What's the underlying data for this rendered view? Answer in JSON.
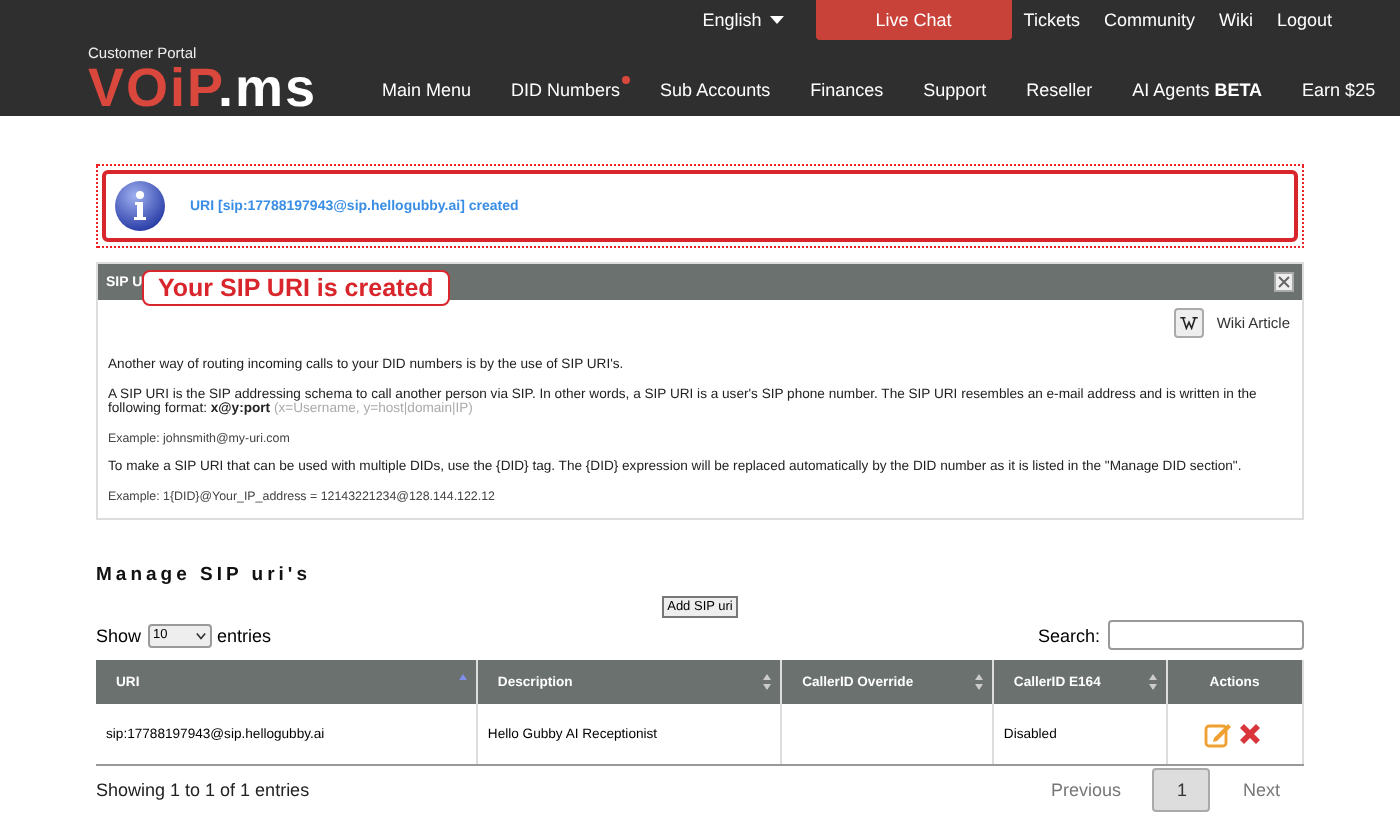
{
  "top_bar": {
    "language": "English",
    "items": [
      {
        "label": "Live Chat",
        "kind": "highlight"
      },
      {
        "label": "Tickets",
        "kind": "link"
      },
      {
        "label": "Community",
        "kind": "link"
      },
      {
        "label": "Wiki",
        "kind": "link"
      },
      {
        "label": "Logout",
        "kind": "link"
      }
    ]
  },
  "brand": {
    "caption": "Customer Portal",
    "logo_main": "VOiP",
    "logo_suffix": ".ms"
  },
  "nav": [
    {
      "label": "Main Menu",
      "badge": false
    },
    {
      "label": "DID Numbers",
      "badge": true
    },
    {
      "label": "Sub Accounts",
      "badge": false
    },
    {
      "label": "Finances",
      "badge": false
    },
    {
      "label": "Support",
      "badge": false
    },
    {
      "label": "Reseller",
      "badge": false
    },
    {
      "label": "AI Agents **BETA**",
      "badge": false
    },
    {
      "label": "Earn $25",
      "badge": false
    }
  ],
  "message": {
    "text": "URI [sip:17788197943@sip.hellogubby.ai] created"
  },
  "panel": {
    "title": "SIP U",
    "callout": "Your SIP URI is created",
    "wiki_link": "Wiki Article",
    "paragraphs": [
      {
        "kind": "text",
        "text": "Another way of routing incoming calls to your DID numbers is by the use of SIP URI's."
      },
      {
        "kind": "text",
        "text": "A SIP URI is the SIP addressing schema to call another person via SIP. In other words, a SIP URI is a user's SIP phone number. The SIP URI resembles an e-mail address and is written in the following format: **x@y:port**",
        "hint": "(x=Username, y=host|domain|IP)"
      },
      {
        "kind": "example",
        "text": "Example: johnsmith@my-uri.com"
      },
      {
        "kind": "text",
        "text": "To make a SIP URI that can be used with multiple DIDs, use the {DID} tag. The {DID} expression will be replaced automatically by the DID number as it is listed in the \"Manage DID section\"."
      },
      {
        "kind": "example",
        "text": "Example: 1{DID}@Your_IP_address = 12143221234@128.144.122.12"
      }
    ]
  },
  "section": {
    "heading": "Manage SIP uri's",
    "add_button": "Add SIP uri",
    "show_label": "Show",
    "page_size": "10",
    "entries_label": "entries",
    "search_label": "Search:"
  },
  "table": {
    "columns": [
      {
        "label": "URI",
        "sortable": true,
        "sorted": true
      },
      {
        "label": "Description",
        "sortable": true,
        "sorted": false
      },
      {
        "label": "CallerID Override",
        "sortable": true,
        "sorted": false
      },
      {
        "label": "CallerID E164",
        "sortable": true,
        "sorted": false
      },
      {
        "label": "Actions",
        "sortable": false
      }
    ],
    "rows": [
      {
        "cells": [
          "sip:17788197943@sip.hellogubby.ai",
          "Hello Gubby AI Receptionist",
          "",
          "Disabled"
        ]
      }
    ]
  },
  "footer": {
    "info": "Showing 1 to 1 of 1 entries",
    "pages": [
      {
        "label": "Previous",
        "disabled": true,
        "selected": false
      },
      {
        "label": "1",
        "disabled": false,
        "selected": true
      },
      {
        "label": "Next",
        "disabled": true,
        "selected": false
      }
    ]
  }
}
